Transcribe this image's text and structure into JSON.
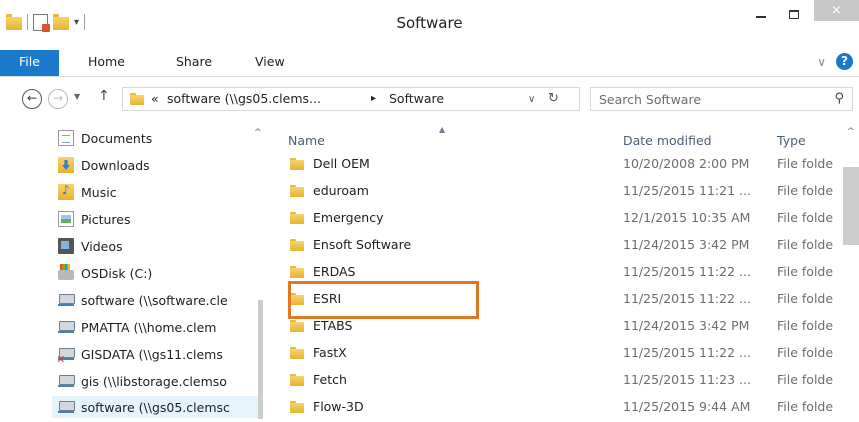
{
  "window": {
    "title": "Software",
    "close_label": "×"
  },
  "ribbon": {
    "tabs": [
      "File",
      "Home",
      "Share",
      "View"
    ],
    "help_label": "?"
  },
  "address": {
    "overflow": "«",
    "crumbs": [
      "software (\\\\gs05.clems...",
      "Software"
    ],
    "separator": "▸"
  },
  "search": {
    "placeholder": "Search Software"
  },
  "navpane": {
    "items": [
      {
        "label": "Documents",
        "icon": "documents-icon"
      },
      {
        "label": "Downloads",
        "icon": "downloads-icon"
      },
      {
        "label": "Music",
        "icon": "music-icon"
      },
      {
        "label": "Pictures",
        "icon": "pictures-icon"
      },
      {
        "label": "Videos",
        "icon": "videos-icon"
      },
      {
        "label": "OSDisk (C:)",
        "icon": "drive-icon"
      },
      {
        "label": "software (\\\\software.cle",
        "icon": "network-drive-icon"
      },
      {
        "label": "PMATTA (\\\\home.clem",
        "icon": "network-drive-icon"
      },
      {
        "label": "GISDATA (\\\\gs11.clems",
        "icon": "disconnected-drive-icon"
      },
      {
        "label": "gis (\\\\libstorage.clemso",
        "icon": "network-drive-icon"
      },
      {
        "label": "software (\\\\gs05.clemsc",
        "icon": "network-drive-icon",
        "selected": true
      }
    ]
  },
  "filelist": {
    "columns": {
      "name": "Name",
      "date": "Date modified",
      "type": "Type"
    },
    "rows": [
      {
        "name": "Dell OEM",
        "date": "10/20/2008 2:00 PM",
        "type": "File folde"
      },
      {
        "name": "eduroam",
        "date": "11/25/2015 11:21 ...",
        "type": "File folde"
      },
      {
        "name": "Emergency",
        "date": "12/1/2015 10:35 AM",
        "type": "File folde"
      },
      {
        "name": "Ensoft Software",
        "date": "11/24/2015 3:42 PM",
        "type": "File folde"
      },
      {
        "name": "ERDAS",
        "date": "11/25/2015 11:22 ...",
        "type": "File folde"
      },
      {
        "name": "ESRI",
        "date": "11/25/2015 11:22 ...",
        "type": "File folde",
        "highlighted": true
      },
      {
        "name": "ETABS",
        "date": "11/24/2015 3:42 PM",
        "type": "File folde"
      },
      {
        "name": "FastX",
        "date": "11/25/2015 11:22 ...",
        "type": "File folde"
      },
      {
        "name": "Fetch",
        "date": "11/25/2015 11:23 ...",
        "type": "File folde"
      },
      {
        "name": "Flow-3D",
        "date": "11/25/2015 9:44 AM",
        "type": "File folde"
      }
    ]
  },
  "colors": {
    "accent": "#1979ca",
    "highlight_box": "#e07722",
    "selection": "#e5f3fb"
  }
}
